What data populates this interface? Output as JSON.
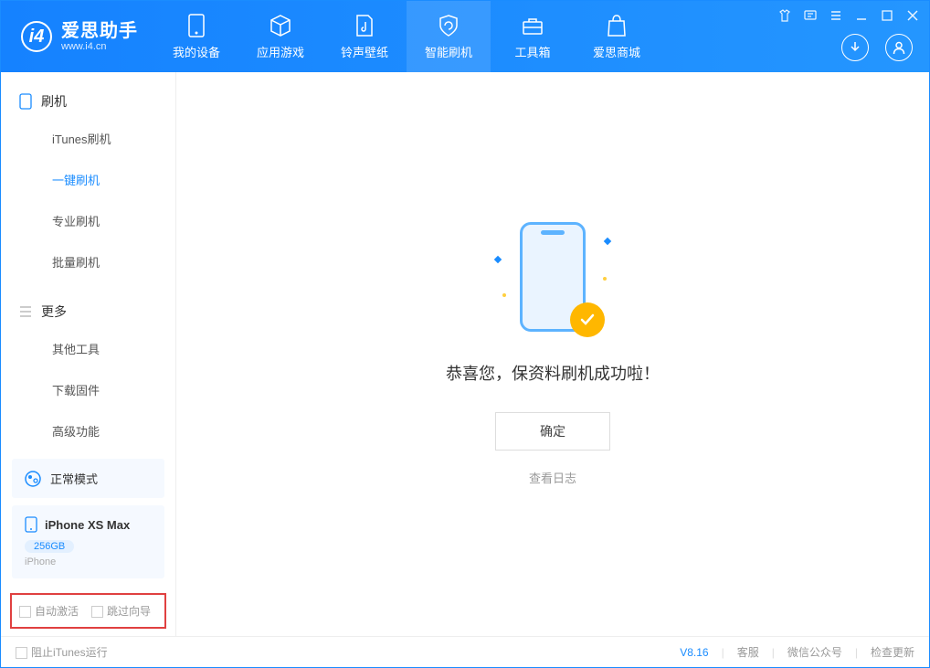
{
  "brand": {
    "name": "爱思助手",
    "url": "www.i4.cn"
  },
  "nav": {
    "my_device": "我的设备",
    "apps_games": "应用游戏",
    "ringtones": "铃声壁纸",
    "smart_flash": "智能刷机",
    "toolbox": "工具箱",
    "store": "爱思商城"
  },
  "sidebar": {
    "section_flash": "刷机",
    "items_flash": {
      "itunes": "iTunes刷机",
      "oneclick": "一键刷机",
      "pro": "专业刷机",
      "batch": "批量刷机"
    },
    "section_more": "更多",
    "items_more": {
      "other_tools": "其他工具",
      "download_fw": "下载固件",
      "advanced": "高级功能"
    }
  },
  "mode": {
    "label": "正常模式"
  },
  "device": {
    "name": "iPhone XS Max",
    "capacity": "256GB",
    "type": "iPhone"
  },
  "checkboxes": {
    "auto_activate": "自动激活",
    "skip_guide": "跳过向导"
  },
  "main": {
    "success": "恭喜您，保资料刷机成功啦！",
    "ok": "确定",
    "view_log": "查看日志"
  },
  "footer": {
    "block_itunes": "阻止iTunes运行",
    "version": "V8.16",
    "support": "客服",
    "wechat": "微信公众号",
    "check_update": "检查更新"
  }
}
